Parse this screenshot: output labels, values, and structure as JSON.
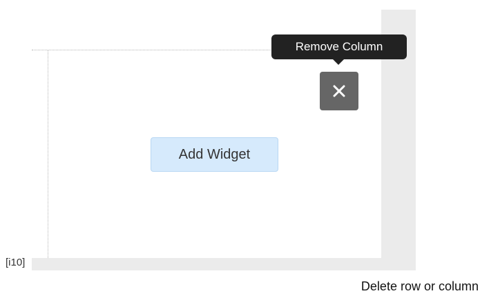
{
  "column": {
    "add_widget_label": "Add Widget",
    "remove_icon": "close-icon",
    "tooltip": "Remove Column"
  },
  "reference_label": "[i10]",
  "caption": "Delete row or column",
  "colors": {
    "add_widget_bg": "#d6eafc",
    "remove_button_bg": "#666666",
    "tooltip_bg": "#222222",
    "gutter_gray": "#ebebeb"
  }
}
